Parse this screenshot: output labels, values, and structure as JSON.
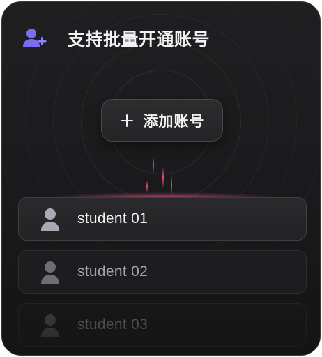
{
  "header": {
    "title": "支持批量开通账号",
    "icon": "add-user-icon"
  },
  "add_button": {
    "label": "添加账号",
    "icon": "plus-icon"
  },
  "students": [
    {
      "label": "student 01",
      "icon": "user-avatar-icon",
      "state": "active"
    },
    {
      "label": "student 02",
      "icon": "user-avatar-icon",
      "state": "dimmed"
    },
    {
      "label": "student 03",
      "icon": "user-avatar-icon",
      "state": "faded"
    }
  ],
  "colors": {
    "background": "#1b1b1d",
    "accent_icon": "#7b6cf2",
    "glow": "#ff4d8a"
  }
}
